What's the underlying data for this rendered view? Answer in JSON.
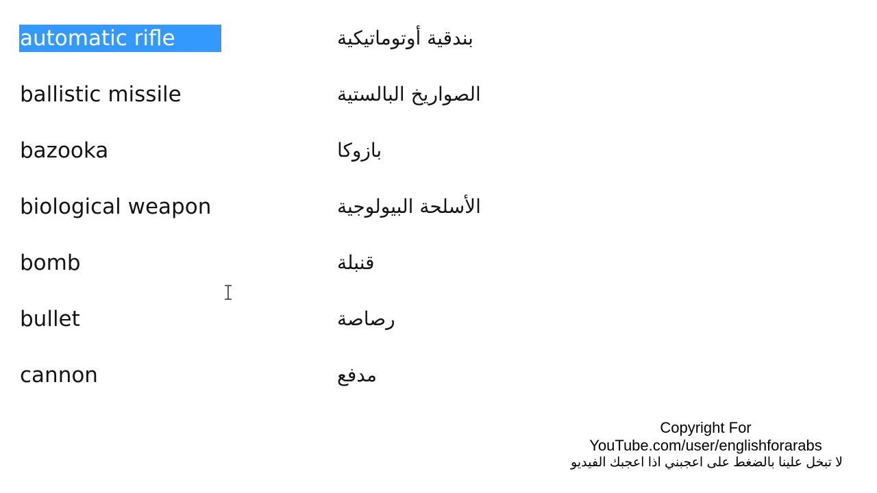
{
  "vocabulary": [
    {
      "english": "automatic rifle",
      "arabic": "بندقية أوتوماتيكية",
      "selected": true
    },
    {
      "english": "ballistic missile",
      "arabic": "الصواريخ البالستية",
      "selected": false
    },
    {
      "english": "bazooka",
      "arabic": "بازوكا",
      "selected": false
    },
    {
      "english": "biological weapon",
      "arabic": "الأسلحة البيولوجية",
      "selected": false
    },
    {
      "english": "bomb",
      "arabic": "قنبلة",
      "selected": false
    },
    {
      "english": "bullet",
      "arabic": "رصاصة",
      "selected": false
    },
    {
      "english": "cannon",
      "arabic": "مدفع",
      "selected": false
    }
  ],
  "footer": {
    "copyright": "Copyright For",
    "channel": "YouTube.com/user/englishforarabs",
    "arabic_note": "لا تبخل علينا بالضغط على اعجبني اذا اعجبك الفيديو"
  },
  "colors": {
    "selection": "#3399ff",
    "text": "#141414",
    "background": "#ffffff"
  },
  "cursor": {
    "icon": "text-ibeam-cursor"
  }
}
